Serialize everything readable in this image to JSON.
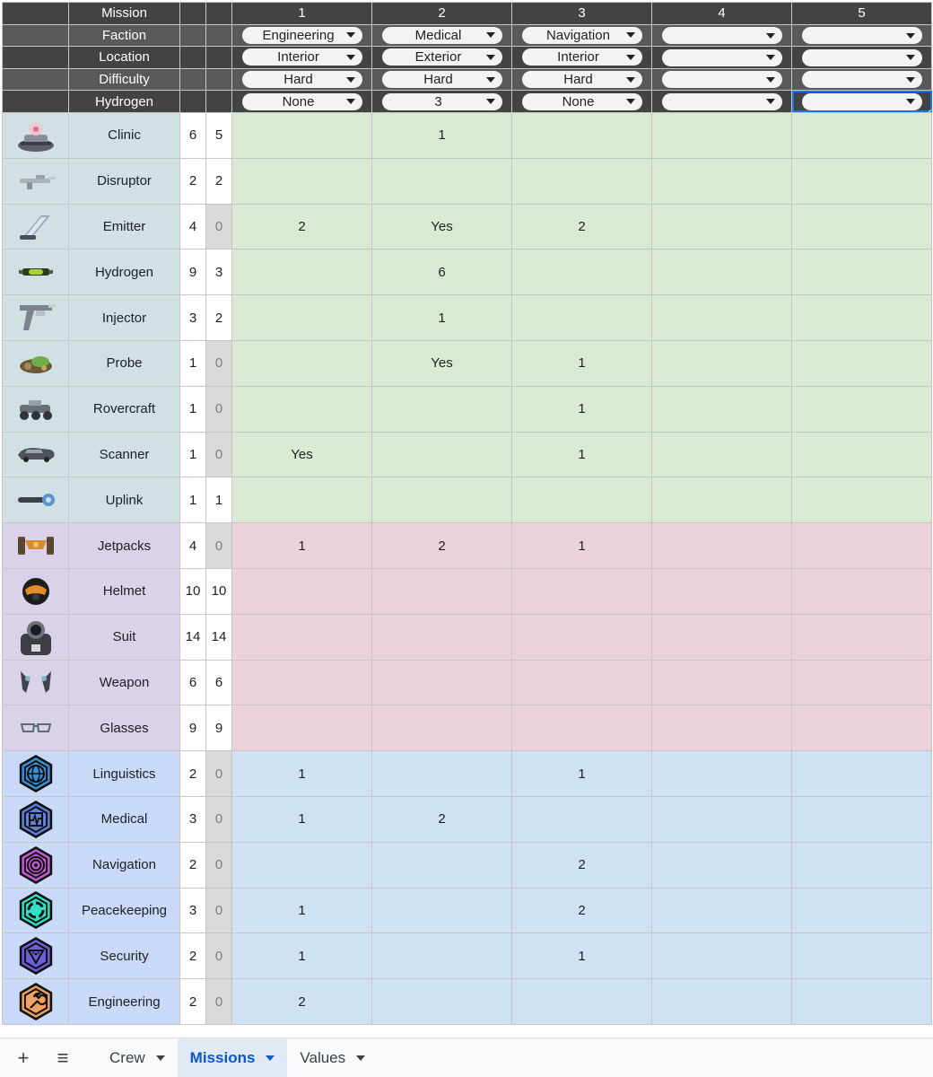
{
  "header_rows": [
    {
      "label": "Mission",
      "dark": true,
      "type": "text",
      "values": [
        "1",
        "2",
        "3",
        "4",
        "5"
      ]
    },
    {
      "label": "Faction",
      "dark": false,
      "type": "dropdown",
      "values": [
        "Engineering",
        "Medical",
        "Navigation",
        "",
        ""
      ]
    },
    {
      "label": "Location",
      "dark": true,
      "type": "dropdown",
      "values": [
        "Interior",
        "Exterior",
        "Interior",
        "",
        ""
      ]
    },
    {
      "label": "Difficulty",
      "dark": false,
      "type": "dropdown",
      "values": [
        "Hard",
        "Hard",
        "Hard",
        "",
        ""
      ]
    },
    {
      "label": "Hydrogen",
      "dark": true,
      "type": "dropdown",
      "values": [
        "None",
        "3",
        "None",
        "",
        ""
      ]
    }
  ],
  "items": [
    {
      "group": "g",
      "icon": "clinic-icon",
      "name": "Clinic",
      "a": "6",
      "b": "5",
      "b_dim": false,
      "m": [
        "",
        "1",
        "",
        "",
        ""
      ]
    },
    {
      "group": "g",
      "icon": "disruptor-icon",
      "name": "Disruptor",
      "a": "2",
      "b": "2",
      "b_dim": false,
      "m": [
        "",
        "",
        "",
        "",
        ""
      ]
    },
    {
      "group": "g",
      "icon": "emitter-icon",
      "name": "Emitter",
      "a": "4",
      "b": "0",
      "b_dim": true,
      "m": [
        "2",
        "Yes",
        "2",
        "",
        ""
      ]
    },
    {
      "group": "g",
      "icon": "hydrogen-icon",
      "name": "Hydrogen",
      "a": "9",
      "b": "3",
      "b_dim": false,
      "m": [
        "",
        "6",
        "",
        "",
        ""
      ]
    },
    {
      "group": "g",
      "icon": "injector-icon",
      "name": "Injector",
      "a": "3",
      "b": "2",
      "b_dim": false,
      "m": [
        "",
        "1",
        "",
        "",
        ""
      ]
    },
    {
      "group": "g",
      "icon": "probe-icon",
      "name": "Probe",
      "a": "1",
      "b": "0",
      "b_dim": true,
      "m": [
        "",
        "Yes",
        "1",
        "",
        ""
      ]
    },
    {
      "group": "g",
      "icon": "rovercraft-icon",
      "name": "Rovercraft",
      "a": "1",
      "b": "0",
      "b_dim": true,
      "m": [
        "",
        "",
        "1",
        "",
        ""
      ]
    },
    {
      "group": "g",
      "icon": "scanner-icon",
      "name": "Scanner",
      "a": "1",
      "b": "0",
      "b_dim": true,
      "m": [
        "Yes",
        "",
        "1",
        "",
        ""
      ]
    },
    {
      "group": "g",
      "icon": "uplink-icon",
      "name": "Uplink",
      "a": "1",
      "b": "1",
      "b_dim": false,
      "m": [
        "",
        "",
        "",
        "",
        ""
      ]
    },
    {
      "group": "p",
      "icon": "jetpacks-icon",
      "name": "Jetpacks",
      "a": "4",
      "b": "0",
      "b_dim": true,
      "m": [
        "1",
        "2",
        "1",
        "",
        ""
      ]
    },
    {
      "group": "p",
      "icon": "helmet-icon",
      "name": "Helmet",
      "a": "10",
      "b": "10",
      "b_dim": false,
      "m": [
        "",
        "",
        "",
        "",
        ""
      ]
    },
    {
      "group": "p",
      "icon": "suit-icon",
      "name": "Suit",
      "a": "14",
      "b": "14",
      "b_dim": false,
      "m": [
        "",
        "",
        "",
        "",
        ""
      ]
    },
    {
      "group": "p",
      "icon": "weapon-icon",
      "name": "Weapon",
      "a": "6",
      "b": "6",
      "b_dim": false,
      "m": [
        "",
        "",
        "",
        "",
        ""
      ]
    },
    {
      "group": "p",
      "icon": "glasses-icon",
      "name": "Glasses",
      "a": "9",
      "b": "9",
      "b_dim": false,
      "m": [
        "",
        "",
        "",
        "",
        ""
      ]
    },
    {
      "group": "b",
      "icon": "linguistics-globe-icon",
      "name": "Linguistics",
      "a": "2",
      "b": "0",
      "b_dim": true,
      "m": [
        "1",
        "",
        "1",
        "",
        ""
      ]
    },
    {
      "group": "b",
      "icon": "medical-pulse-icon",
      "name": "Medical",
      "a": "3",
      "b": "0",
      "b_dim": true,
      "m": [
        "1",
        "2",
        "",
        "",
        ""
      ]
    },
    {
      "group": "b",
      "icon": "navigation-target-icon",
      "name": "Navigation",
      "a": "2",
      "b": "0",
      "b_dim": true,
      "m": [
        "",
        "",
        "2",
        "",
        ""
      ]
    },
    {
      "group": "b",
      "icon": "peacekeeping-ring-icon",
      "name": "Peacekeeping",
      "a": "3",
      "b": "0",
      "b_dim": true,
      "m": [
        "1",
        "",
        "2",
        "",
        ""
      ]
    },
    {
      "group": "b",
      "icon": "security-triangle-icon",
      "name": "Security",
      "a": "2",
      "b": "0",
      "b_dim": true,
      "m": [
        "1",
        "",
        "1",
        "",
        ""
      ]
    },
    {
      "group": "b",
      "icon": "engineering-wrench-icon",
      "name": "Engineering",
      "a": "2",
      "b": "0",
      "b_dim": true,
      "m": [
        "2",
        "",
        "",
        "",
        ""
      ]
    }
  ],
  "tabbar": {
    "add_label": "+",
    "menu_label": "≡",
    "tabs": [
      {
        "label": "Crew",
        "active": false
      },
      {
        "label": "Missions",
        "active": true
      },
      {
        "label": "Values",
        "active": false
      }
    ]
  },
  "colors": {
    "header_dark": "#434343",
    "header_mid": "#595959",
    "green_name": "#d0e0e3",
    "green_cell": "#d9ead3",
    "purple_name": "#d9d2e9",
    "pink_cell": "#ead1dc",
    "blue_name": "#c9daf8",
    "blue_cell": "#cfe2f3",
    "selection": "#1a73e8"
  }
}
